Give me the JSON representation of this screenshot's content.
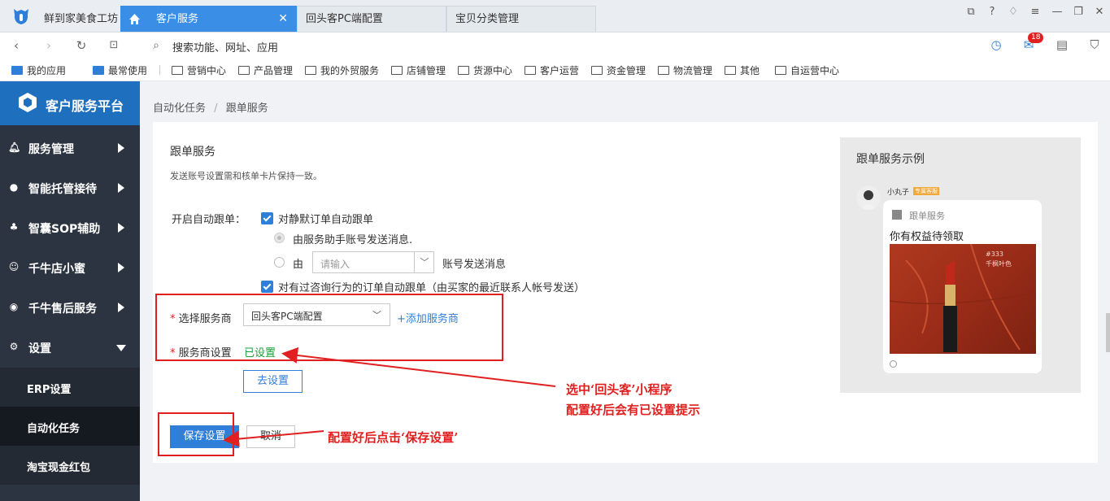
{
  "app": {
    "name": "鲜到家美食工坊"
  },
  "tabs": [
    {
      "label": "客户服务",
      "active": true
    },
    {
      "label": "回头客PC端配置",
      "active": false
    },
    {
      "label": "宝贝分类管理",
      "active": false
    }
  ],
  "nav": {
    "address_placeholder": "搜索功能、网址、应用",
    "mail_badge": "18"
  },
  "bookmarks": [
    "我的应用",
    "最常使用",
    "营销中心",
    "产品管理",
    "我的外贸服务",
    "店铺管理",
    "货源中心",
    "客户运营",
    "资金管理",
    "物流管理",
    "其他",
    "自运营中心"
  ],
  "sidebar": {
    "brand": "客户服务平台",
    "menu": [
      {
        "label": "服务管理",
        "icon": "bell-icon",
        "expanded": false
      },
      {
        "label": "智能托管接待",
        "icon": "bulb-icon",
        "expanded": false
      },
      {
        "label": "智囊SOP辅助",
        "icon": "users-icon",
        "expanded": false
      },
      {
        "label": "千牛店小蜜",
        "icon": "robot-icon",
        "expanded": false
      },
      {
        "label": "千牛售后服务",
        "icon": "shield-icon",
        "expanded": false
      },
      {
        "label": "设置",
        "icon": "gear-icon",
        "expanded": true
      }
    ],
    "submenu": [
      {
        "label": "ERP设置",
        "active": false
      },
      {
        "label": "自动化任务",
        "active": true
      },
      {
        "label": "淘宝现金红包",
        "active": false
      }
    ]
  },
  "breadcrumb": {
    "parent": "自动化任务",
    "separator": "/",
    "current": "跟单服务"
  },
  "form": {
    "title": "跟单服务",
    "description": "发送账号设置需和核单卡片保持一致。",
    "auto_follow_label": "开启自动跟单：",
    "silent_order_checkbox": "对静默订单自动跟单",
    "radio_assistant": "由服务助手账号发送消息.",
    "radio_custom_prefix": "由",
    "account_select_placeholder": "请输入",
    "radio_custom_suffix": "账号发送消息",
    "consult_order_checkbox": "对有过咨询行为的订单自动跟单（由买家的最近联系人帐号发送）",
    "provider_label": "选择服务商",
    "provider_value": "回头客PC端配置",
    "add_provider": "+添加服务商",
    "provider_setting_label": "服务商设置",
    "provider_setting_status": "已设置",
    "go_setting_button": "去设置",
    "save_button": "保存设置",
    "cancel_button": "取消",
    "required_mark": "*"
  },
  "example": {
    "title": "跟单服务示例",
    "sender_name": "小丸子",
    "sender_tag": "专属客服",
    "card_label": "跟单服务",
    "card_title": "你有权益待领取",
    "image_text_1": "#333",
    "image_text_2": "千枫叶色"
  },
  "annotations": {
    "note1_line1": "选中‘回头客’小程序",
    "note1_line2": "配置好后会有已设置提示",
    "note2": "配置好后点击‘保存设置’"
  },
  "colors": {
    "accent": "#2f7ed8",
    "annotation": "#e02020",
    "success": "#19a038",
    "sidebar": "#2b3440"
  }
}
